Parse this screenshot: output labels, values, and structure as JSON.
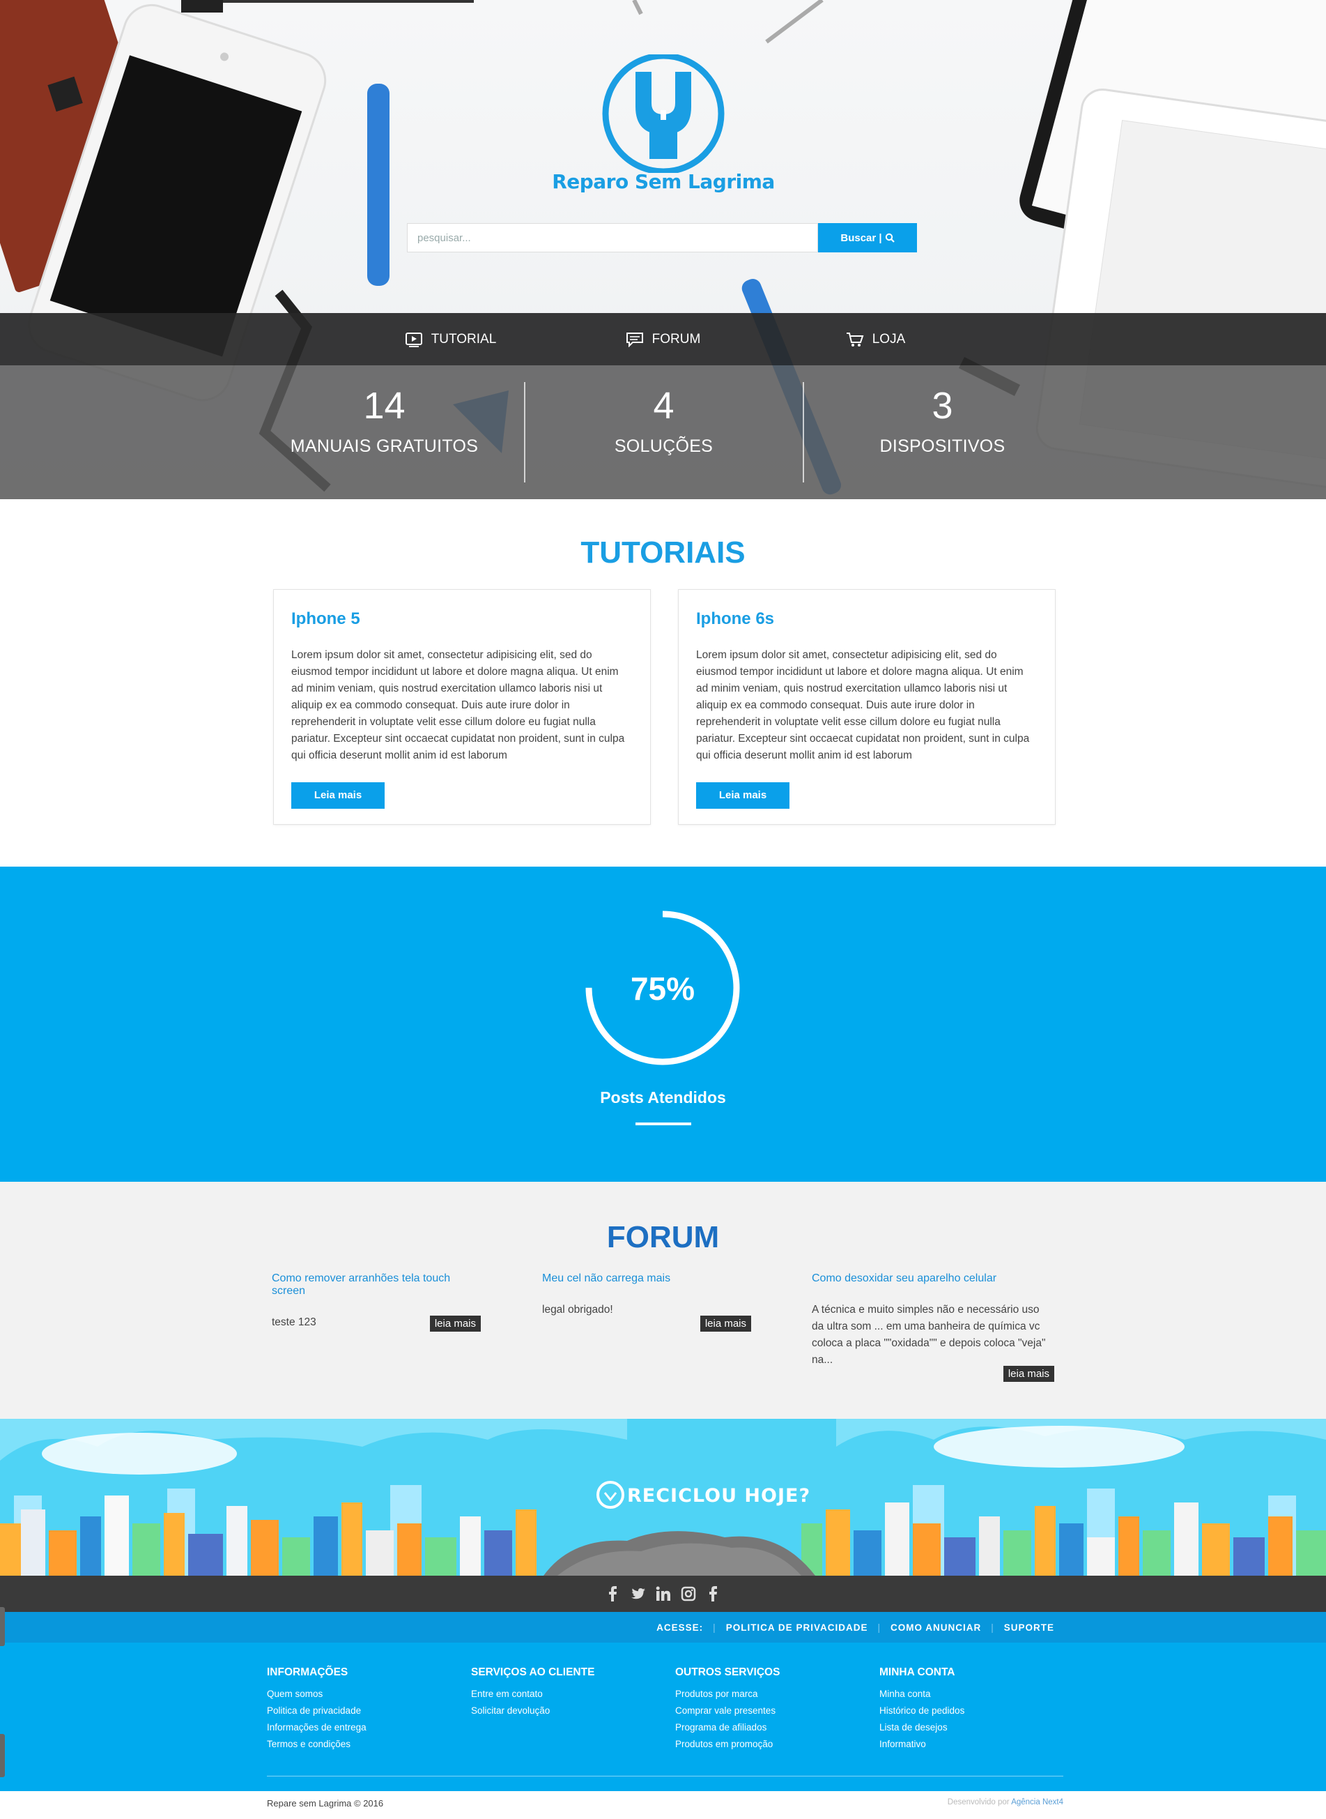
{
  "brand": {
    "name": "Reparo Sem Lagrima"
  },
  "search": {
    "placeholder": "pesquisar...",
    "button_label": "Buscar |"
  },
  "nav": [
    {
      "label": "TUTORIAL",
      "icon": "video-icon"
    },
    {
      "label": "FORUM",
      "icon": "chat-icon"
    },
    {
      "label": "LOJA",
      "icon": "cart-icon"
    }
  ],
  "stats": [
    {
      "value": "14",
      "label": "MANUAIS GRATUITOS"
    },
    {
      "value": "4",
      "label": "SOLUÇÕES"
    },
    {
      "value": "3",
      "label": "DISPOSITIVOS"
    }
  ],
  "tutorials": {
    "title": "TUTORIAIS",
    "cards": [
      {
        "title": "Iphone 5",
        "body": "Lorem ipsum dolor sit amet, consectetur adipisicing elit, sed do eiusmod tempor incididunt ut labore et dolore magna aliqua. Ut enim ad minim veniam, quis nostrud exercitation ullamco laboris nisi ut aliquip ex ea commodo consequat. Duis aute irure dolor in reprehenderit in voluptate velit esse cillum dolore eu fugiat nulla pariatur. Excepteur sint occaecat cupidatat non proident, sunt in culpa qui officia deserunt mollit anim id est laborum",
        "button": "Leia mais"
      },
      {
        "title": "Iphone 6s",
        "body": "Lorem ipsum dolor sit amet, consectetur adipisicing elit, sed do eiusmod tempor incididunt ut labore et dolore magna aliqua. Ut enim ad minim veniam, quis nostrud exercitation ullamco laboris nisi ut aliquip ex ea commodo consequat. Duis aute irure dolor in reprehenderit in voluptate velit esse cillum dolore eu fugiat nulla pariatur. Excepteur sint occaecat cupidatat non proident, sunt in culpa qui officia deserunt mollit anim id est laborum",
        "button": "Leia mais"
      }
    ]
  },
  "progress": {
    "value_text": "75%",
    "fraction": 0.75,
    "label": "Posts Atendidos"
  },
  "forum": {
    "title": "FORUM",
    "posts": [
      {
        "title": "Como remover arranhões tela touch screen",
        "body": "teste 123",
        "button": "leia mais"
      },
      {
        "title": "Meu cel não carrega mais",
        "body": "legal obrigado!",
        "button": "leia mais"
      },
      {
        "title": "Como desoxidar seu aparelho celular",
        "body": "A técnica e muito simples não e necessário uso da ultra som ... em uma banheira de química vc coloca a placa \"\"oxidada\"\" e depois coloca \"veja\" na...",
        "button": "leia mais"
      }
    ]
  },
  "banner": {
    "text": "RECICLOU HOJE?"
  },
  "social": [
    "facebook-icon",
    "twitter-icon",
    "linkedin-icon",
    "instagram-icon",
    "facebook-icon"
  ],
  "acesse": {
    "label": "ACESSE:",
    "links": [
      "POLITICA DE PRIVACIDADE",
      "COMO ANUNCIAR",
      "SUPORTE"
    ]
  },
  "footer": {
    "columns": [
      {
        "title": "INFORMAÇÕES",
        "links": [
          "Quem somos",
          "Politica de privacidade",
          "Informações de entrega",
          "Termos e condições"
        ]
      },
      {
        "title": "SERVIÇOS AO CLIENTE",
        "links": [
          "Entre em contato",
          "Solicitar devolução"
        ]
      },
      {
        "title": "OUTROS SERVIÇOS",
        "links": [
          "Produtos por marca",
          "Comprar vale presentes",
          "Programa de afiliados",
          "Produtos em promoção"
        ]
      },
      {
        "title": "MINHA CONTA",
        "links": [
          "Minha conta",
          "Histórico de pedidos",
          "Lista de desejos",
          "Informativo"
        ]
      }
    ],
    "copyright": "Repare sem Lagrima © 2016",
    "developer_prefix": "Desenvolvido por",
    "developer_name": "Agência Next4"
  },
  "colors": {
    "primary": "#00aaee",
    "brand_blue": "#1a9ee3",
    "forum_blue": "#1d6fc2",
    "dark": "#333333"
  }
}
